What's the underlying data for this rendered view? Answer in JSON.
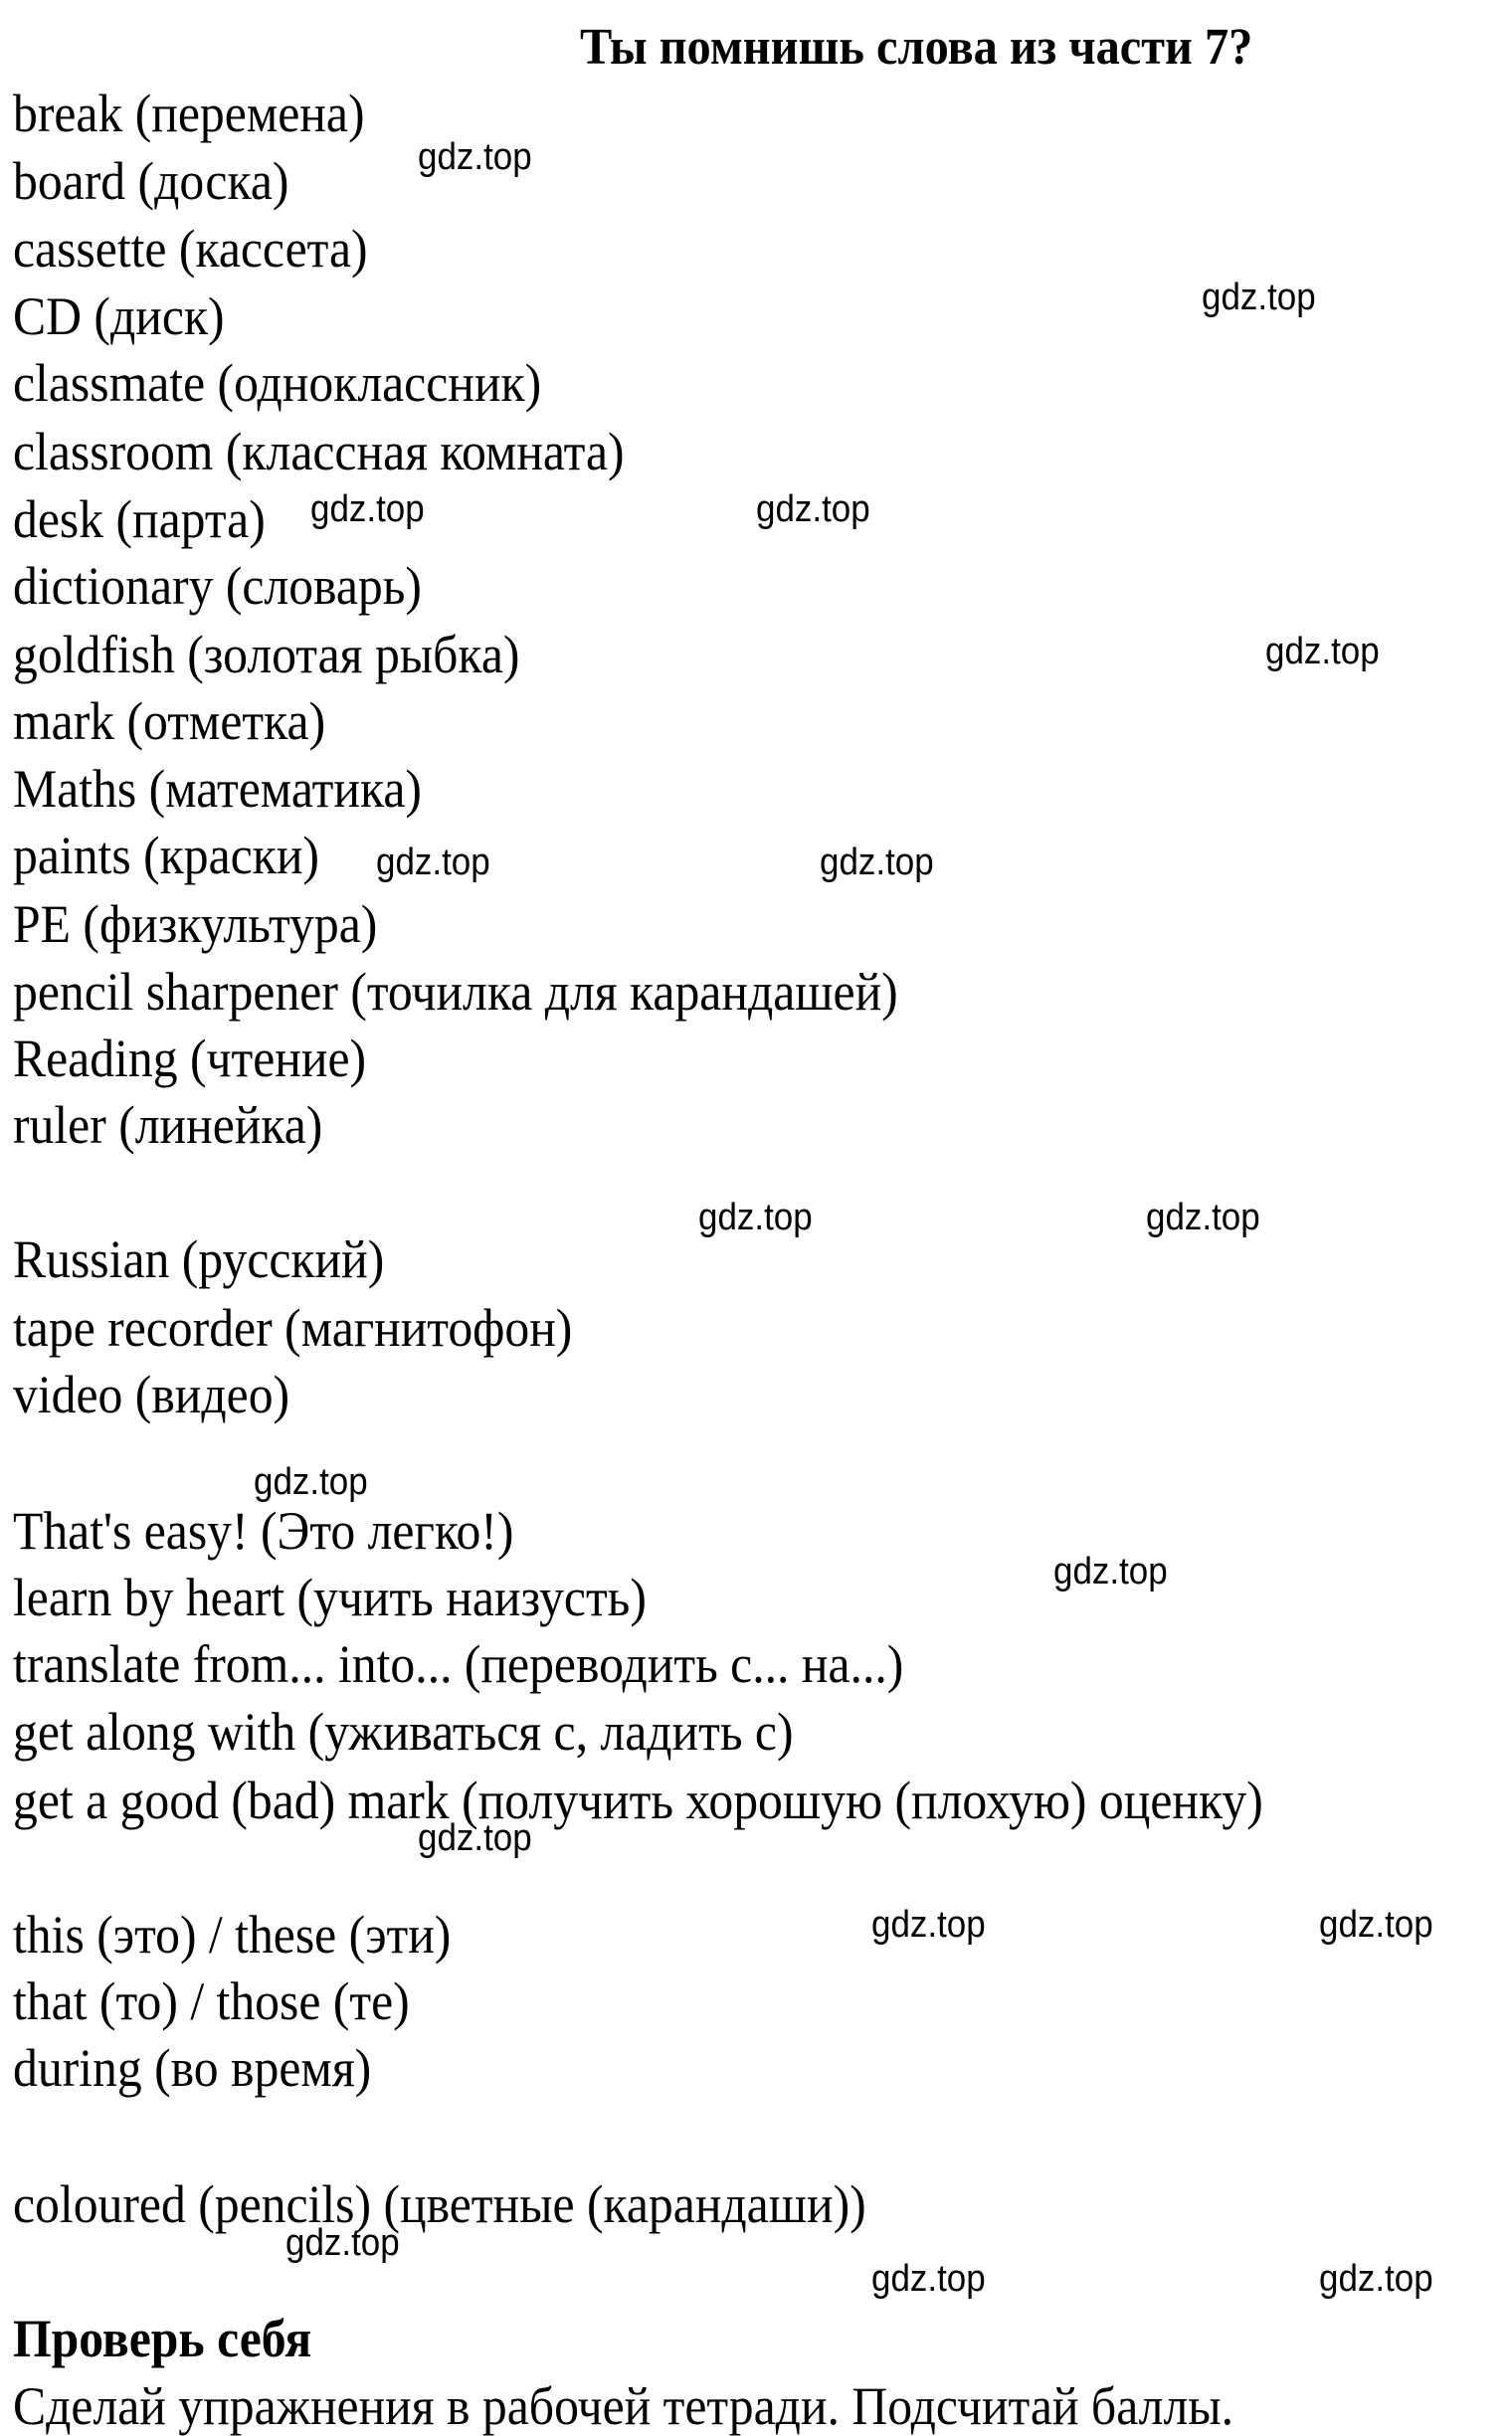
{
  "title": "Ты помнишь слова из части 7?",
  "vocabulary": [
    "break (перемена)",
    "board (доска)",
    "cassette (кассета)",
    "CD (диск)",
    "classmate (одноклассник)",
    "classroom (классная комната)",
    "desk (парта)",
    "dictionary (словарь)",
    "goldfish (золотая рыбка)",
    "mark (отметка)",
    "Maths (математика)",
    "paints (краски)",
    "PE (физкультура)",
    "pencil sharpener (точилка для карандашей)",
    "Reading (чтение)",
    "ruler (линейка)",
    "Russian (русский)",
    "tape recorder (магнитофон)",
    "video (видео)",
    "That's easy! (Это легко!)",
    "learn by heart (учить наизусть)",
    "translate from... into... (переводить с... на...)",
    "get along with (уживаться с, ладить с)",
    "get a good (bad) mark (получить хорошую (плохую) оценку)",
    "this (это) / these (эти)",
    "that (то) / those (те)",
    "during (во время)",
    "coloured (pencils) (цветные (карандаши))"
  ],
  "check_yourself": {
    "heading": "Проверь себя",
    "instruction": "Сделай упражнения в рабочей тетради. Подсчитай баллы."
  },
  "watermark": "gdz.top"
}
